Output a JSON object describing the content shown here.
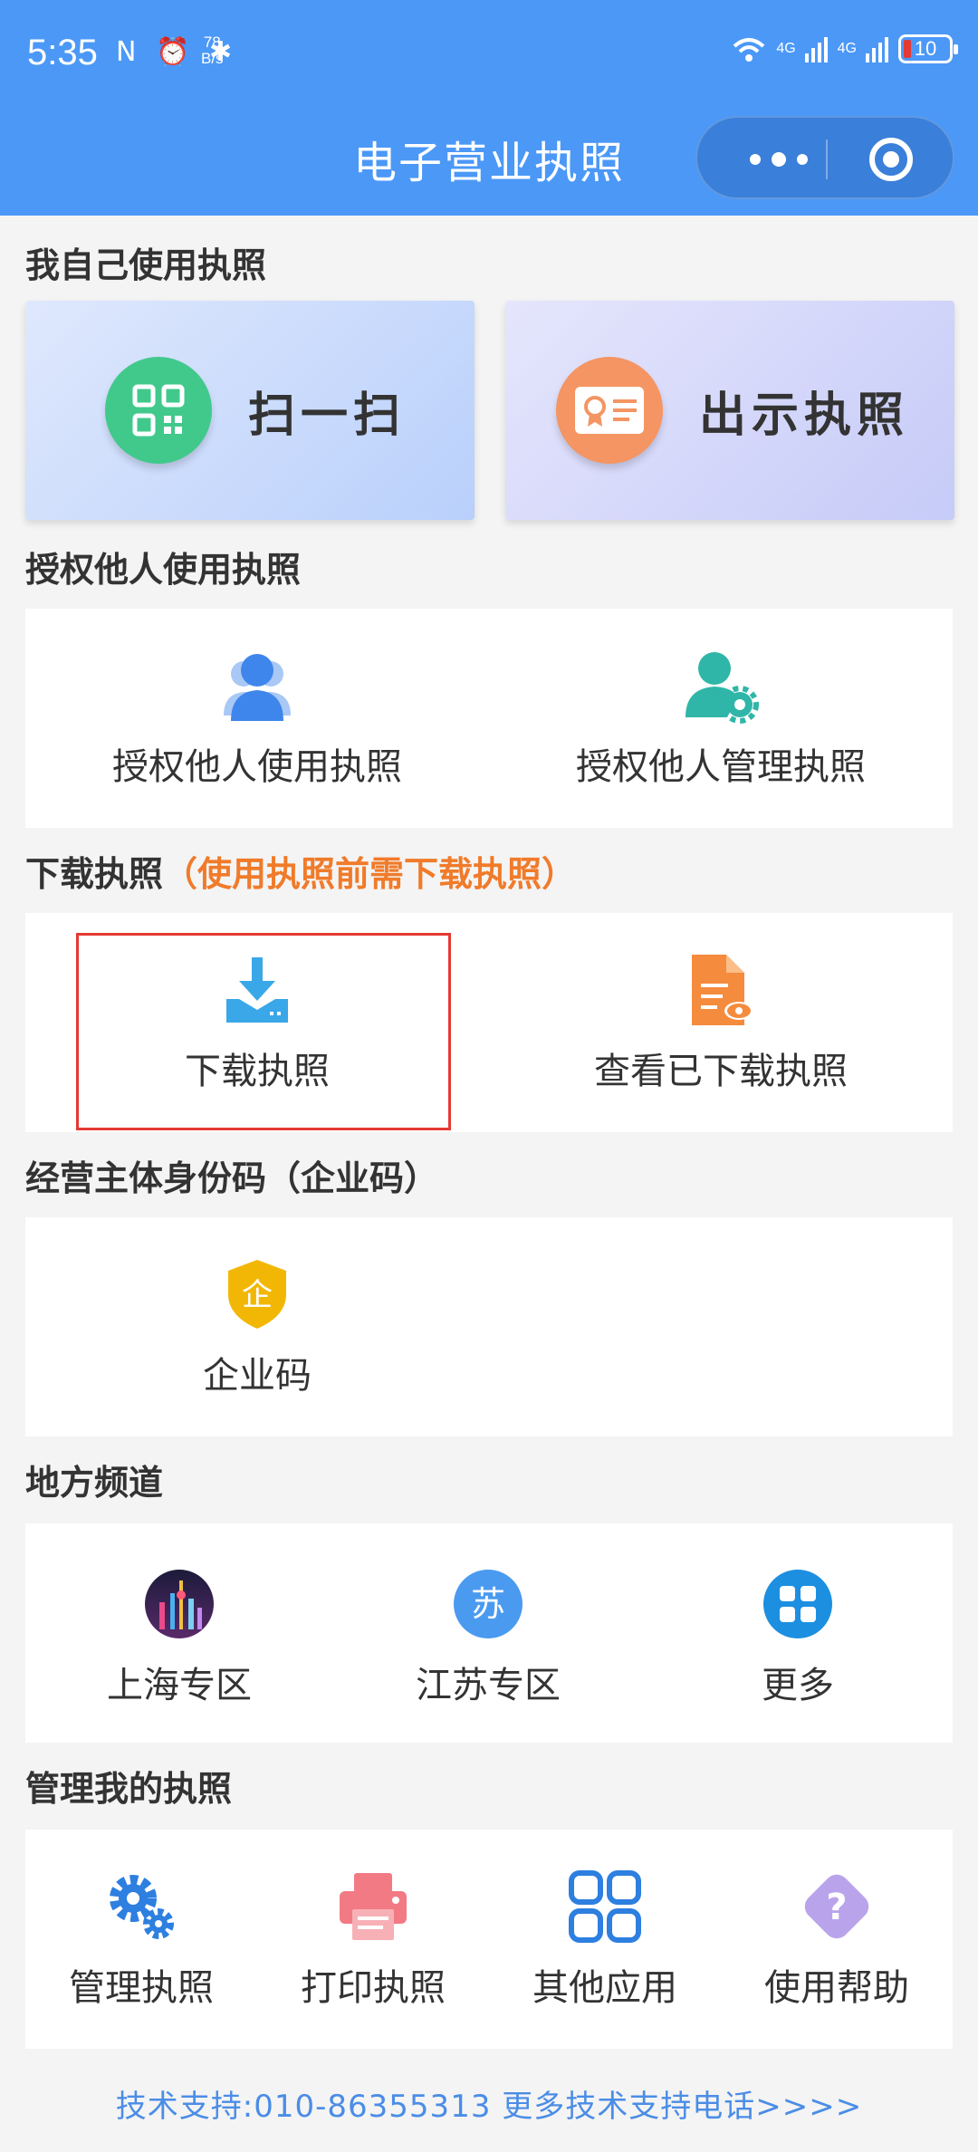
{
  "status_bar": {
    "time": "5:35",
    "left_icons": "N ⏰ ✱",
    "net_speed_value": "78",
    "net_speed_unit": "B/s",
    "signal_1": "4G",
    "signal_2": "4G",
    "battery": "10"
  },
  "nav": {
    "title": "电子营业执照"
  },
  "sections": {
    "self_use": "我自己使用执照",
    "authorize": "授权他人使用执照",
    "download": "下载执照",
    "download_note": "（使用执照前需下载执照）",
    "entity_code": "经营主体身份码（企业码）",
    "local": "地方频道",
    "manage": "管理我的执照"
  },
  "big_cards": {
    "scan": "扫一扫",
    "show": "出示执照"
  },
  "authorize_items": {
    "use": "授权他人使用执照",
    "manage": "授权他人管理执照"
  },
  "download_items": {
    "download": "下载执照",
    "view": "查看已下载执照"
  },
  "entity_items": {
    "code": "企业码",
    "badge_char": "企"
  },
  "local_items": {
    "shanghai": "上海专区",
    "jiangsu": "江苏专区",
    "jiangsu_char": "苏",
    "more": "更多"
  },
  "manage_items": {
    "manage": "管理执照",
    "print": "打印执照",
    "apps": "其他应用",
    "help": "使用帮助",
    "help_char": "?"
  },
  "footer": {
    "support": "技术支持:010-86355313  更多技术支持电话>>>>"
  },
  "colors": {
    "header": "#4b98f7",
    "accent_orange": "#f07b2a",
    "highlight_red": "#e53935",
    "link_blue": "#4b8de6"
  }
}
